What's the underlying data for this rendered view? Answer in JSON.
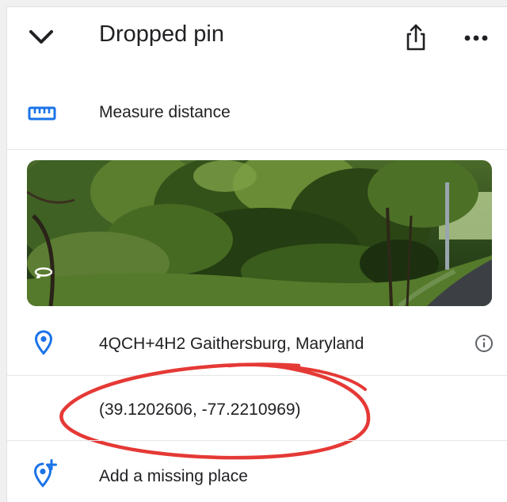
{
  "header": {
    "title": "Dropped pin",
    "collapse_icon": "chevron-down-icon",
    "share_icon": "share-icon",
    "more_icon": "more-horizontal-icon"
  },
  "measure": {
    "label": "Measure distance",
    "icon": "ruler-icon"
  },
  "street_view": {
    "icon": "street-view-rotate-icon"
  },
  "place": {
    "plus_code": "4QCH+4H2 Gaithersburg, Maryland",
    "pin_icon": "location-pin-icon",
    "info_icon": "info-icon"
  },
  "coordinates": {
    "text": "(39.1202606, -77.2210969)"
  },
  "add_place": {
    "label": "Add a missing place",
    "icon": "add-location-icon"
  },
  "colors": {
    "accent_blue": "#1a73e8",
    "annotation_red": "#e53935",
    "icon_dark": "#3c4043"
  }
}
